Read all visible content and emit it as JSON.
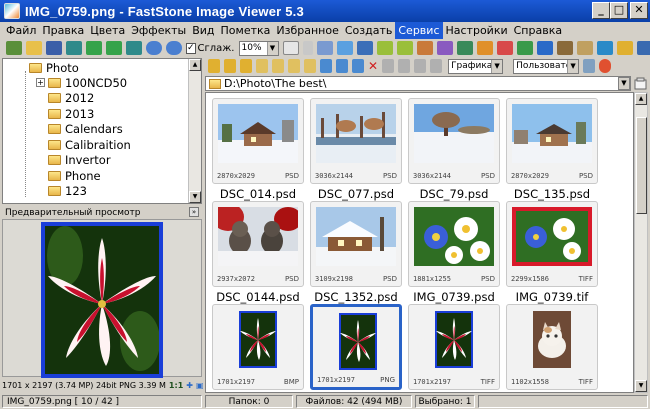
{
  "window": {
    "title": "IMG_0759.png  -  FastStone Image Viewer 5.3",
    "minimize": "_",
    "maximize": "□",
    "close": "✕"
  },
  "menu": [
    "Файл",
    "Правка",
    "Цвета",
    "Эффекты",
    "Вид",
    "Пометка",
    "Избранное",
    "Создать",
    "Сервис",
    "Настройки",
    "Справка"
  ],
  "menu_active_index": 8,
  "toolbar": {
    "smooth_label": "Сглаж.",
    "smooth_checked": true,
    "zoom_value": "10%"
  },
  "folder_tree": {
    "root": "Photo",
    "items": [
      "100NCD50",
      "2012",
      "2013",
      "Calendars",
      "Calibraition",
      "Invertor",
      "Phone",
      "123"
    ]
  },
  "preview": {
    "header": "Предварительный просмотр",
    "collapse_glyph": "»",
    "info": "1701 x 2197 (3.74 MP)  24bit  PNG  3.39 M",
    "ratio": "1:1"
  },
  "navigation": {
    "filter_value": "Графика",
    "sort_value": "Пользовател"
  },
  "path": "D:\\Photo\\The best\\",
  "thumbnails": [
    {
      "name": "DSC_014.psd",
      "dims": "2870x2029",
      "format": "PSD",
      "scene": "winter-house"
    },
    {
      "name": "DSC_077.psd",
      "dims": "3036x2144",
      "format": "PSD",
      "scene": "winter-lake"
    },
    {
      "name": "DSC_79.psd",
      "dims": "3036x2144",
      "format": "PSD",
      "scene": "winter-field"
    },
    {
      "name": "DSC_135.psd",
      "dims": "2870x2029",
      "format": "PSD",
      "scene": "winter-house-2"
    },
    {
      "name": "DSC_0144.psd",
      "dims": "2937x2072",
      "format": "PSD",
      "scene": "cats-snow"
    },
    {
      "name": "DSC_1352.psd",
      "dims": "3109x2198",
      "format": "PSD",
      "scene": "snow-house"
    },
    {
      "name": "IMG_0739.psd",
      "dims": "1881x1255",
      "format": "PSD",
      "scene": "flowers-blue"
    },
    {
      "name": "IMG_0739.tif",
      "dims": "2299x1586",
      "format": "TIFF",
      "scene": "flowers-red"
    },
    {
      "name": "",
      "dims": "1701x2197",
      "format": "BMP",
      "scene": "lily"
    },
    {
      "name": "",
      "dims": "1701x2197",
      "format": "PNG",
      "scene": "lily"
    },
    {
      "name": "",
      "dims": "1701x2197",
      "format": "TIFF",
      "scene": "lily"
    },
    {
      "name": "",
      "dims": "1102x1558",
      "format": "TIFF",
      "scene": "kitten"
    }
  ],
  "selected_thumbnail_index": 9,
  "status": {
    "file": "IMG_0759.png [ 10 / 42 ]",
    "folders": "Папок: 0",
    "files": "Файлов: 42 (494 МВ)",
    "selected": "Выбрано: 1"
  },
  "colors": {
    "title_bar": "#1c5ad6",
    "selection_border": "#2a63c8",
    "preview_border": "#1a3ed8"
  }
}
